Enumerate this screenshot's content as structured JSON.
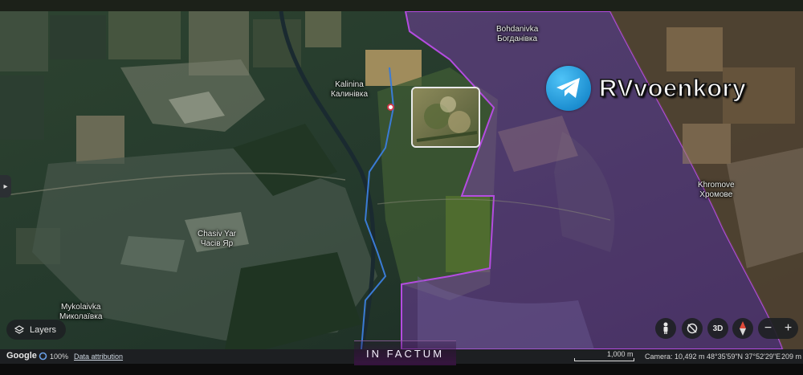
{
  "watermark": {
    "channel": "RVvoenkory",
    "producer": "IN FACTUM"
  },
  "places": [
    {
      "id": "kalinina",
      "latin": "Kalinina",
      "cyrillic": "Калинівка"
    },
    {
      "id": "bohdanivka",
      "latin": "Bohdanivka",
      "cyrillic": "Богданівка"
    },
    {
      "id": "khromove",
      "latin": "Khromove",
      "cyrillic": "Хромове"
    },
    {
      "id": "chasiv-yar",
      "latin": "Chasiv Yar",
      "cyrillic": "Часів Яр"
    },
    {
      "id": "mykolaivka",
      "latin": "Mykolaivka",
      "cyrillic": "Миколаївка"
    }
  ],
  "controls": {
    "layers_label": "Layers",
    "view_3d_label": "3D",
    "zoom_out": "−",
    "zoom_in": "+",
    "icons": [
      "pegman-icon",
      "rotate-icon",
      "compass-icon",
      "layers-icon",
      "chevron-right-icon"
    ]
  },
  "status_bar": {
    "logo": "Google",
    "zoom": "100%",
    "data_attribution": "Data attribution",
    "scale": "1,000 m",
    "camera": "Camera: 10,492 m",
    "coordinates": "48°35'59\"N 37°52'29\"E",
    "elevation": "209 m"
  },
  "colors": {
    "occupied_overlay": "#8a3fc4",
    "occupied_border": "#b44ce0",
    "front_line": "#3a7bd5",
    "telegram_blue": "#229ed9"
  }
}
